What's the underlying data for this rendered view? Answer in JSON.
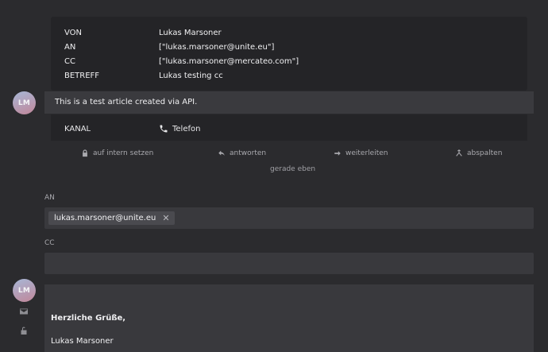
{
  "article": {
    "avatar_initials": "LM",
    "meta": [
      {
        "key": "VON",
        "value": "Lukas Marsoner"
      },
      {
        "key": "AN",
        "value": "[\"lukas.marsoner@unite.eu\"]"
      },
      {
        "key": "CC",
        "value": "[\"lukas.marsoner@mercateo.com\"]"
      },
      {
        "key": "BETREFF",
        "value": "Lukas testing cc"
      }
    ],
    "body": "This is a test article created via API.",
    "channel_key": "KANAL",
    "channel_value": "Telefon",
    "actions": [
      {
        "label": "auf intern setzen",
        "icon": "lock-icon"
      },
      {
        "label": "antworten",
        "icon": "reply-icon"
      },
      {
        "label": "weiterleiten",
        "icon": "forward-icon"
      },
      {
        "label": "abspalten",
        "icon": "split-icon"
      }
    ],
    "timestamp": "gerade eben"
  },
  "reply": {
    "to_label": "AN",
    "to_chip": "lukas.marsoner@unite.eu",
    "chip_remove": "✕",
    "cc_label": "CC",
    "cc_value": "",
    "avatar_initials": "LM",
    "greeting": "Herzliche Grüße,",
    "signature_name": "Lukas Marsoner"
  }
}
